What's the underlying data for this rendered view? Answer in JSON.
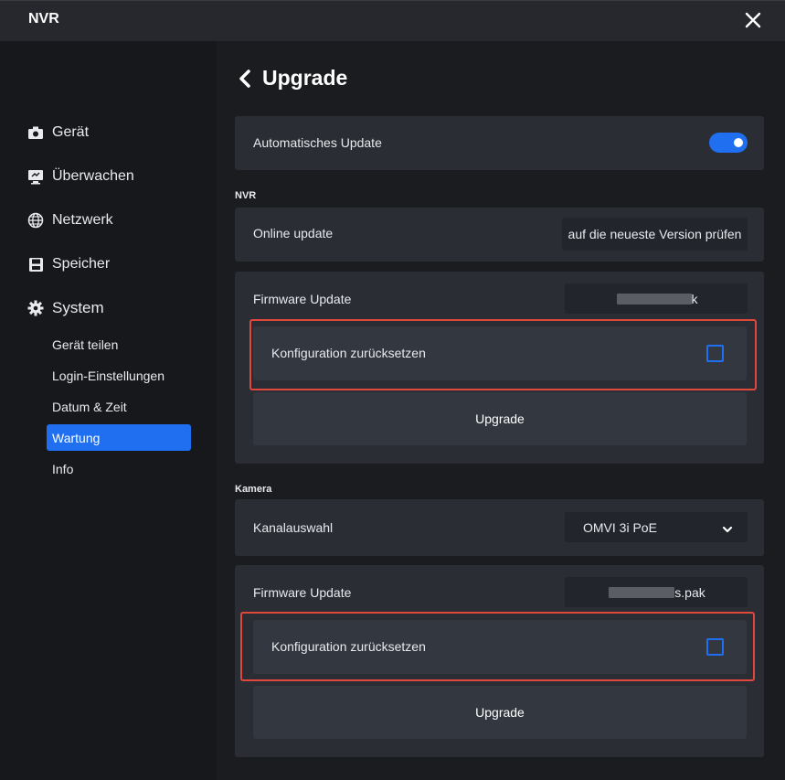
{
  "window": {
    "title": "NVR"
  },
  "sidebar": {
    "items": [
      {
        "label": "Gerät",
        "icon": "camera-icon"
      },
      {
        "label": "Überwachen",
        "icon": "monitor-icon"
      },
      {
        "label": "Netzwerk",
        "icon": "globe-icon"
      },
      {
        "label": "Speicher",
        "icon": "floppy-disk-icon"
      },
      {
        "label": "System",
        "icon": "gear-icon"
      }
    ],
    "system_subitems": [
      {
        "label": "Gerät teilen"
      },
      {
        "label": "Login-Einstellungen"
      },
      {
        "label": "Datum & Zeit"
      },
      {
        "label": "Wartung",
        "active": true
      },
      {
        "label": "Info"
      }
    ]
  },
  "page": {
    "title": "Upgrade",
    "auto_update": {
      "label": "Automatisches Update",
      "enabled": true
    },
    "nvr": {
      "section_label": "NVR",
      "online_update_label": "Online update",
      "check_button_label": "auf die neueste Version prüfen",
      "firmware_label": "Firmware Update",
      "firmware_file_suffix": "k",
      "reset_label": "Konfiguration zurücksetzen",
      "reset_checked": false,
      "upgrade_button": "Upgrade"
    },
    "camera": {
      "section_label": "Kamera",
      "channel_label": "Kanalauswahl",
      "channel_value": "OMVI 3i PoE",
      "firmware_label": "Firmware Update",
      "firmware_file_suffix": "s.pak",
      "reset_label": "Konfiguration zurücksetzen",
      "reset_checked": false,
      "upgrade_button": "Upgrade"
    }
  },
  "colors": {
    "accent": "#1f6ff0",
    "highlight": "#e0483d",
    "card": "#2a2d34",
    "inner": "#33373f",
    "sidebar": "#17181c"
  }
}
